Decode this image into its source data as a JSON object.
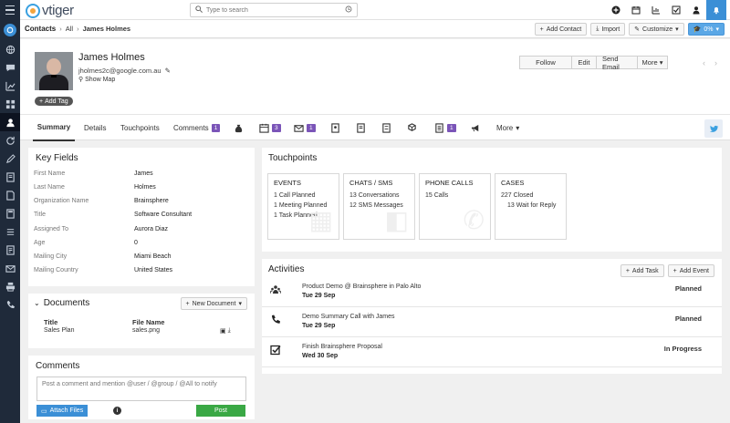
{
  "app": {
    "logo_text": "vtiger"
  },
  "search": {
    "placeholder": "Type to search"
  },
  "breadcrumb": {
    "module": "Contacts",
    "all": "All",
    "record": "James Holmes"
  },
  "crumb_actions": {
    "add_contact": "Add Contact",
    "import": "Import",
    "customize": "Customize",
    "percent": "0%"
  },
  "contact": {
    "name": "James Holmes",
    "email": "jholmes2c@google.com.au",
    "show_map": "Show Map",
    "add_tag": "Add Tag"
  },
  "header_buttons": {
    "follow": "Follow",
    "edit": "Edit",
    "send_email": "Send Email",
    "more": "More"
  },
  "tabs": {
    "summary": "Summary",
    "details": "Details",
    "touchpoints": "Touchpoints",
    "comments": "Comments",
    "comments_count": "1",
    "calendar_count": "3",
    "email_count": "1",
    "doc_count": "1",
    "more": "More"
  },
  "key_fields": {
    "title": "Key Fields",
    "rows": [
      {
        "label": "First Name",
        "value": "James"
      },
      {
        "label": "Last Name",
        "value": "Holmes"
      },
      {
        "label": "Organization Name",
        "value": "Brainsphere"
      },
      {
        "label": "Title",
        "value": "Software Consultant"
      },
      {
        "label": "Assigned To",
        "value": "Aurora Diaz"
      },
      {
        "label": "Age",
        "value": "0"
      },
      {
        "label": "Mailing City",
        "value": "Miami Beach"
      },
      {
        "label": "Mailing Country",
        "value": "United States"
      }
    ]
  },
  "documents": {
    "title": "Documents",
    "new_document": "New Document",
    "col_title": "Title",
    "col_file": "File Name",
    "rows": [
      {
        "title": "Sales Plan",
        "file": "sales.png"
      }
    ]
  },
  "comments": {
    "title": "Comments",
    "placeholder": "Post a comment and mention @user / @group / @All to notify",
    "attach": "Attach Files",
    "post": "Post"
  },
  "touchpoints": {
    "title": "Touchpoints",
    "cards": [
      {
        "heading": "EVENTS",
        "lines": [
          "1 Call Planned",
          "1 Meeting Planned",
          "1 Task Planned"
        ]
      },
      {
        "heading": "CHATS / SMS",
        "lines": [
          "13  Conversations",
          "12  SMS Messages"
        ]
      },
      {
        "heading": "PHONE CALLS",
        "lines": [
          "15  Calls"
        ]
      },
      {
        "heading": "CASES",
        "lines": [
          "227  Closed",
          "13  Wait for Reply"
        ]
      }
    ]
  },
  "activities": {
    "title": "Activities",
    "add_task": "Add Task",
    "add_event": "Add Event",
    "rows": [
      {
        "icon": "meeting-icon",
        "title": "Product Demo @ Brainsphere in Palo Alto",
        "date": "Tue 29 Sep",
        "status": "Planned"
      },
      {
        "icon": "phone-icon",
        "title": "Demo Summary Call with James",
        "date": "Tue 29 Sep",
        "status": "Planned"
      },
      {
        "icon": "task-check-icon",
        "title": "Finish Brainsphere Proposal",
        "date": "Wed 30 Sep",
        "status": "In Progress"
      }
    ]
  }
}
